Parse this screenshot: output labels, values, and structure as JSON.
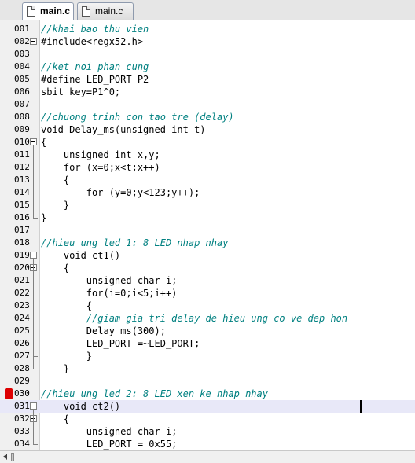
{
  "tabs": [
    {
      "label": "main.c",
      "active": true
    },
    {
      "label": "main.c",
      "active": false
    }
  ],
  "editor": {
    "current_line": "031",
    "breakpoint_line": "030",
    "lines": [
      {
        "num": "001",
        "text": "//khai bao thu vien",
        "kind": "comment"
      },
      {
        "num": "002",
        "text": "#include<regx52.h>",
        "kind": "preproc",
        "fold": true
      },
      {
        "num": "003",
        "text": "",
        "kind": "plain"
      },
      {
        "num": "004",
        "text": "//ket noi phan cung",
        "kind": "comment"
      },
      {
        "num": "005",
        "text": "#define LED_PORT P2",
        "kind": "preproc"
      },
      {
        "num": "006",
        "text": "sbit key=P1^0;",
        "kind": "plain"
      },
      {
        "num": "007",
        "text": "",
        "kind": "plain"
      },
      {
        "num": "008",
        "text": "//chuong trinh con tao tre (delay)",
        "kind": "comment"
      },
      {
        "num": "009",
        "text": "void Delay_ms(unsigned int t)",
        "kind": "plain"
      },
      {
        "num": "010",
        "text": "{",
        "kind": "plain",
        "fold": true
      },
      {
        "num": "011",
        "text": "    unsigned int x,y;",
        "kind": "plain"
      },
      {
        "num": "012",
        "text": "    for (x=0;x<t;x++)",
        "kind": "plain"
      },
      {
        "num": "013",
        "text": "    {",
        "kind": "plain"
      },
      {
        "num": "014",
        "text": "        for (y=0;y<123;y++);",
        "kind": "plain"
      },
      {
        "num": "015",
        "text": "    }",
        "kind": "plain"
      },
      {
        "num": "016",
        "text": "}",
        "kind": "plain"
      },
      {
        "num": "017",
        "text": "",
        "kind": "plain"
      },
      {
        "num": "018",
        "text": "//hieu ung led 1: 8 LED nhap nhay",
        "kind": "comment"
      },
      {
        "num": "019",
        "text": "    void ct1()",
        "kind": "plain",
        "fold": true
      },
      {
        "num": "020",
        "text": "    {",
        "kind": "plain",
        "fold": true
      },
      {
        "num": "021",
        "text": "        unsigned char i;",
        "kind": "plain"
      },
      {
        "num": "022",
        "text": "        for(i=0;i<5;i++)",
        "kind": "plain"
      },
      {
        "num": "023",
        "text": "        {",
        "kind": "plain"
      },
      {
        "num": "024",
        "text": "        //giam gia tri delay de hieu ung co ve dep hon",
        "kind": "comment"
      },
      {
        "num": "025",
        "text": "        Delay_ms(300);",
        "kind": "plain"
      },
      {
        "num": "026",
        "text": "        LED_PORT =~LED_PORT;",
        "kind": "plain"
      },
      {
        "num": "027",
        "text": "        }",
        "kind": "plain"
      },
      {
        "num": "028",
        "text": "    }",
        "kind": "plain"
      },
      {
        "num": "029",
        "text": "",
        "kind": "plain"
      },
      {
        "num": "030",
        "text": "//hieu ung led 2: 8 LED xen ke nhap nhay",
        "kind": "comment"
      },
      {
        "num": "031",
        "text": "    void ct2()",
        "kind": "plain",
        "fold": true
      },
      {
        "num": "032",
        "text": "    {",
        "kind": "plain",
        "fold": true
      },
      {
        "num": "033",
        "text": "        unsigned char i;",
        "kind": "plain"
      },
      {
        "num": "034",
        "text": "        LED_PORT = 0x55;",
        "kind": "plain"
      }
    ]
  },
  "colors": {
    "comment": "#008080",
    "keyword": "#000080",
    "number": "#800080",
    "current_line_bg": "#e8e8f8",
    "breakpoint": "#dd0000"
  }
}
